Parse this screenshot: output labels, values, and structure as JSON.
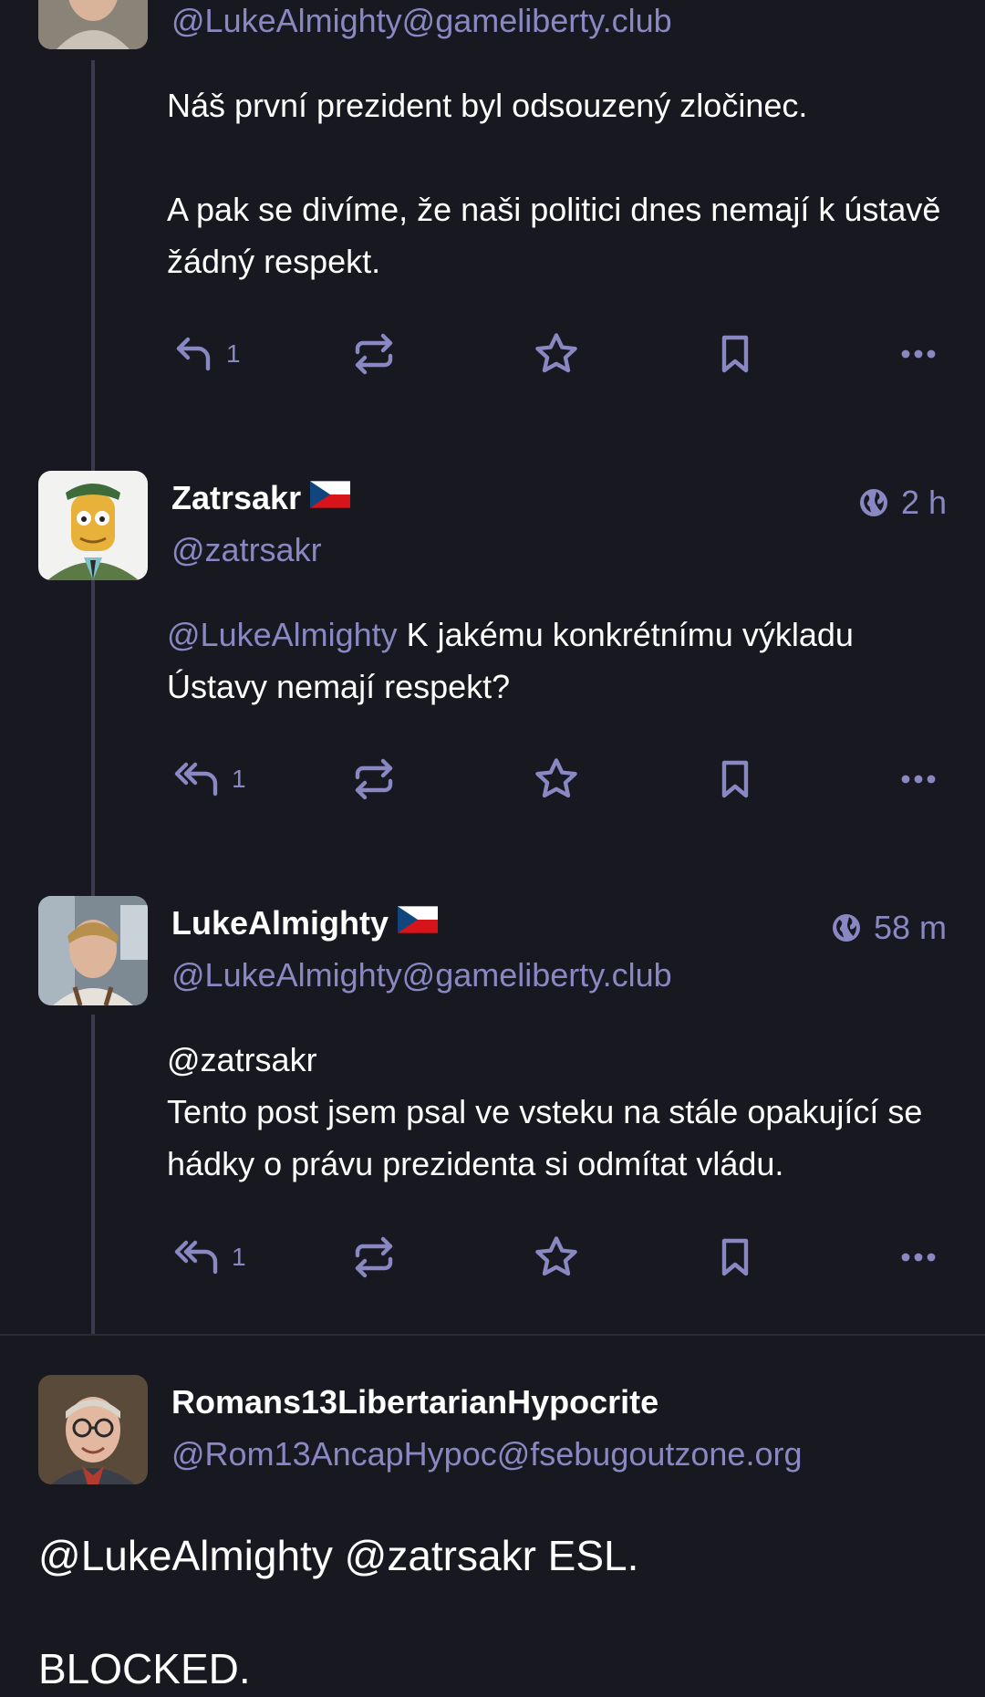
{
  "posts": [
    {
      "handle": "@LukeAlmighty@gameliberty.club",
      "paragraphs": [
        "Náš první prezident byl odsouzený zločinec.",
        "A pak se divíme, že naši politici dnes nemají k ústavě žádný respekt."
      ],
      "reply_count": "1",
      "reply_icon": "reply-icon"
    },
    {
      "name": "Zatrsakr",
      "handle": "@zatrsakr",
      "time": "2 h",
      "mention": "@LukeAlmighty",
      "text": " K jakému konkrétnímu výkladu Ústavy nemají respekt?",
      "reply_count": "1",
      "reply_icon": "reply-all-icon"
    },
    {
      "name": "LukeAlmighty",
      "handle": "@LukeAlmighty@gameliberty.club",
      "time": "58 m",
      "mention": "@zatrsakr",
      "text": "Tento post jsem psal ve vsteku na stále opakující se hádky o právu prezidenta si odmítat vládu.",
      "reply_count": "1",
      "reply_icon": "reply-all-icon"
    },
    {
      "name": "Romans13LibertarianHypocrite",
      "handle": "@Rom13AncapHypoc@fsebugoutzone.org",
      "mention1": "@LukeAlmighty",
      "mention2": "@zatrsakr",
      "text": " ESL.",
      "text2": "BLOCKED."
    }
  ],
  "colors": {
    "background": "#181821",
    "accent": "#8a88c2",
    "text": "#ffffff",
    "thread_line": "#3a3a4c"
  }
}
